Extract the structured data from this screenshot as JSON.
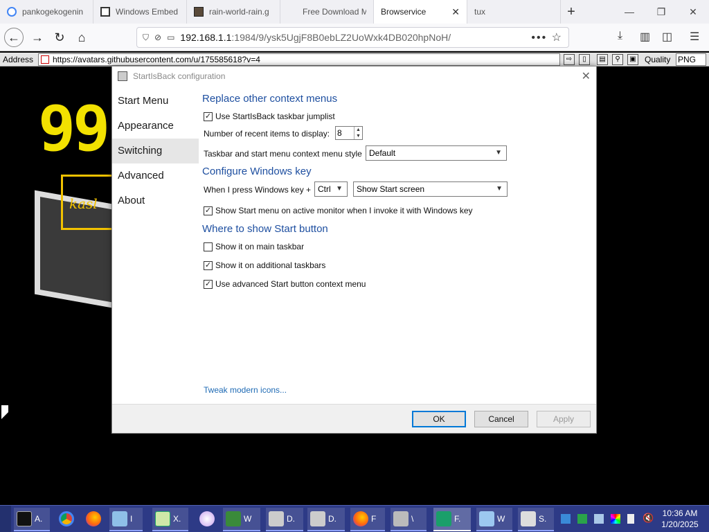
{
  "browser": {
    "tabs": [
      {
        "label": "pankogekogenin",
        "icon": "google-g-icon"
      },
      {
        "label": "Windows Embed",
        "icon": "windows-icon"
      },
      {
        "label": "rain-world-rain.g",
        "icon": "image-icon"
      },
      {
        "label": "Free Download M",
        "icon": ""
      },
      {
        "label": "Browservice",
        "icon": "",
        "active": true
      },
      {
        "label": "tux",
        "icon": ""
      }
    ],
    "tab_close": "✕",
    "new_tab": "+",
    "url_host": "192.168.1.1",
    "url_path": ":1984/9/ysk5UgjF8B0ebLZ2UoWxk4DB020hpNoH/",
    "url_menu": "•••"
  },
  "address_toolbar": {
    "label": "Address",
    "url": "https://avatars.githubusercontent.com/u/175585618?v=4",
    "quality_label": "Quality",
    "format": "PNG"
  },
  "dialog": {
    "title": "StartIsBack configuration",
    "nav": [
      "Start Menu",
      "Appearance",
      "Switching",
      "Advanced",
      "About"
    ],
    "selected_nav": "Switching",
    "sections": {
      "context_menus": "Replace other context menus",
      "windows_key": "Configure Windows key",
      "start_button": "Where to show Start button"
    },
    "options": {
      "use_jumplist": {
        "label": "Use StartIsBack taskbar jumplist",
        "checked": true
      },
      "recent_items_label": "Number of recent items to display:",
      "recent_items_value": "8",
      "context_style_label": "Taskbar and start menu context menu style",
      "context_style_value": "Default",
      "win_key_label": "When I press Windows key +",
      "win_key_modifier": "Ctrl",
      "win_key_action": "Show Start screen",
      "active_monitor": {
        "label": "Show Start menu on active monitor when I invoke it with Windows key",
        "checked": true
      },
      "main_taskbar": {
        "label": "Show it on main taskbar",
        "checked": false
      },
      "additional_taskbars": {
        "label": "Show it on additional taskbars",
        "checked": true
      },
      "advanced_context": {
        "label": "Use advanced Start button context menu",
        "checked": true
      }
    },
    "tweak_link": "Tweak modern icons...",
    "buttons": {
      "ok": "OK",
      "cancel": "Cancel",
      "apply": "Apply"
    }
  },
  "background": {
    "big_text": "99",
    "scribble": "kasl"
  },
  "taskbar": {
    "items": [
      {
        "label": "A.",
        "icon": "terminal-icon"
      },
      {
        "label": "",
        "icon": "chrome-icon"
      },
      {
        "label": "",
        "icon": "firefox-icon"
      },
      {
        "label": "I",
        "icon": "notepad-icon"
      },
      {
        "label": "X.",
        "icon": "spreadsheet-icon"
      },
      {
        "label": "",
        "icon": "paint-icon"
      },
      {
        "label": "W",
        "icon": "window-icon"
      },
      {
        "label": "D.",
        "icon": "drive-icon"
      },
      {
        "label": "D.",
        "icon": "drive-icon"
      },
      {
        "label": "F",
        "icon": "firefox-icon"
      },
      {
        "label": "\\",
        "icon": "network-icon"
      },
      {
        "label": "F.",
        "icon": "app-f-icon"
      },
      {
        "label": "W",
        "icon": "doc-icon"
      },
      {
        "label": "S.",
        "icon": "server-icon"
      }
    ],
    "time": "10:36 AM",
    "date": "1/20/2025"
  }
}
